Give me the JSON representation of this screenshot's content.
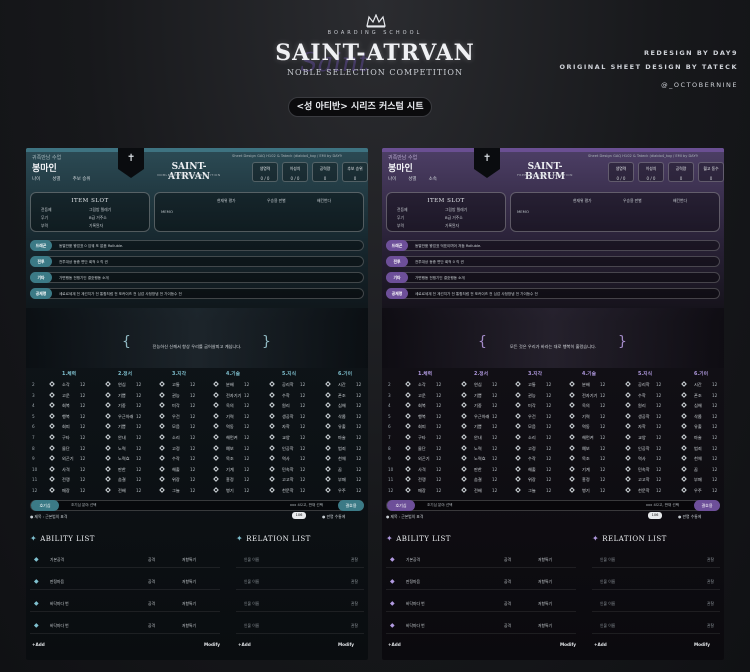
{
  "header": {
    "school_tag": "BOARDING SCHOOL",
    "logo_title": "SAINT-ATRVAN",
    "logo_script": "Saint",
    "logo_subtitle": "NOBLE SELECTION COMPETITION",
    "credit_1": "REDESIGN BY DAY9",
    "credit_2": "ORIGINAL SHEET DESIGN BY TATECK",
    "handle": "@_OCTOBERNINE",
    "sheet_title": "<성 아티반> 시리즈 커스텀 시트"
  },
  "colors": {
    "teal": "#3b7a86",
    "purple": "#6d4f99",
    "background": "#17181b"
  },
  "sheets": [
    {
      "id": "teal",
      "label": "귀족만남 수업",
      "name": "봉마인",
      "logo": "SAINT-ATRVAN",
      "logo_sub": "NOBLE SELECTION COMPETITION",
      "credit": "Sheet Design GAQ H102 & Tateck (diablo4_tog / EMI by DAY9",
      "info": [
        "나이",
        "성별",
        "추보 승위"
      ],
      "stats": [
        {
          "label": "생명력",
          "value": "0 / 0"
        },
        {
          "label": "이성치",
          "value": "0 / 0"
        },
        {
          "label": "공력량",
          "value": "0"
        },
        {
          "label": "추보 승위",
          "value": "0"
        }
      ],
      "item_slot_title": "ITEM SLOT",
      "item_slots": [
        "전등제",
        "그림방 텔레기",
        "무기",
        "B급 거주소",
        "부력",
        "기록된자"
      ],
      "memo_label": "MEMO",
      "memo_items": [
        "현재위 평가",
        "우승용 판별",
        "배킨번다"
      ],
      "fields": [
        {
          "tag": "드래곤",
          "text": "동열반품    왕업표 0    임궤 또 없음    Rolluble."
        },
        {
          "tag": "전투",
          "text": "전투대상    동종 면단    회적 0    직 권"
        },
        {
          "tag": "기타",
          "text": "가변행동    전쟁기인    결호행동    소개"
        },
        {
          "tag": "공재명",
          "text": "세로르세계 전    계선지가 전    통합처럼 전    포커이즈 전    심감    사정망념 전    가이등수 전"
        }
      ],
      "banner_text": "전능하신 신께서 항상 우리를 굽어살피고 계십니다.",
      "categories": [
        "1.체력",
        "2.정서",
        "3.지각",
        "4.기술",
        "5.지식",
        "6.기이"
      ],
      "grid_rows": [
        [
          "2",
          "소각",
          "연심",
          "고통",
          "분배",
          "공리학",
          "시간"
        ],
        [
          "3",
          "고운",
          "기쁨",
          "권능",
          "전자기기",
          "수학",
          "폰조"
        ],
        [
          "4",
          "회복",
          "기중",
          "미각",
          "옥의",
          "원리",
          "심해"
        ],
        [
          "5",
          "행복",
          "우근아래",
          "우건",
          "기력",
          "생공학",
          "삭롭"
        ],
        [
          "6",
          "회피",
          "기쁨",
          "모음",
          "역동",
          "자학",
          "유출"
        ],
        [
          "7",
          "구타",
          "안내",
          "소리",
          "해먼켜",
          "교양",
          "마술"
        ],
        [
          "8",
          "물단",
          "노력",
          "고정",
          "예보",
          "인공학",
          "범죄"
        ],
        [
          "9",
          "외곤기",
          "노력효",
          "수작",
          "목조",
          "역사",
          "천체"
        ],
        [
          "10",
          "사격",
          "판한",
          "해출",
          "기계",
          "민속학",
          "꿈"
        ],
        [
          "11",
          "전쟁",
          "숨결",
          "위장",
          "흥정",
          "고고학",
          "부패"
        ],
        [
          "12",
          "매장",
          "전배",
          "그늘",
          "병기",
          "천문학",
          "우주"
        ]
      ],
      "grid_value": "12",
      "foot_bar": {
        "label": "호기심",
        "text": "조기심 분야 선택",
        "right": "xxx 4으고, 판재 선택",
        "roll": "결호용"
      },
      "sub_line": {
        "text": "● 제목 : 근본법의 표격",
        "pill": "106",
        "right": "● 판명 수통에"
      },
      "ability_title": "ABILITY LIST",
      "relation_title": "RELATION LIST",
      "abilities": [
        {
          "name": "기본공격",
          "t1": "공격",
          "t2": "저항특기"
        },
        {
          "name": "판정마음",
          "t1": "공격",
          "t2": "저항특기"
        },
        {
          "name": "바닥마다 번",
          "t1": "공격",
          "t2": "저항특기"
        },
        {
          "name": "바닥마다 번",
          "t1": "공격",
          "t2": "저항특기"
        }
      ],
      "relations": [
        {
          "name": "인물 이름",
          "key": "관찰"
        },
        {
          "name": "인물 이름",
          "key": "관찰"
        },
        {
          "name": "인물 이름",
          "key": "관찰"
        },
        {
          "name": "인물 이름",
          "key": "관찰"
        }
      ],
      "add_label": "+Add",
      "modify_label": "Modify"
    },
    {
      "id": "purple",
      "label": "귀족만남 수업",
      "name": "봉마인",
      "logo": "SAINT-BARUM",
      "logo_sub": "FREEDOM COME SIMULATION",
      "credit": "Sheet Design GAQ H102 & Tateck (diablo4_tog / EMI by DAY9",
      "info": [
        "나이",
        "성별",
        "소속"
      ],
      "stats": [
        {
          "label": "생명력",
          "value": "0 / 0"
        },
        {
          "label": "이성치",
          "value": "0 / 0"
        },
        {
          "label": "공력량",
          "value": "0"
        },
        {
          "label": "월고 동수",
          "value": "0"
        }
      ],
      "item_slot_title": "ITEM SLOT",
      "item_slots": [
        "전등제",
        "그림방 텔레기",
        "무기",
        "B급 거주소",
        "부력",
        "기록된자"
      ],
      "memo_label": "MEMO",
      "memo_items": [
        "현재위 평가",
        "우승용 판별",
        "배킨번다"
      ],
      "fields": [
        {
          "tag": "드래곤",
          "text": "동열반품    왕업표    억표이며어 저둠    Rolluble."
        },
        {
          "tag": "전투",
          "text": "전투대상    동종 면단    회적 0    직 권"
        },
        {
          "tag": "기타",
          "text": "가변행동    전쟁기인    결호행동    소개"
        },
        {
          "tag": "공재명",
          "text": "세로르세계 전    계선지가 전    통합처럼 전    포커이즈 전    심감    사정망념 전    가이등수 전"
        }
      ],
      "banner_text": "모든 것은 우리가 바라는 대로 행복히 흘렀습니다.",
      "categories": [
        "1.체력",
        "2.정서",
        "3.지각",
        "4.기술",
        "5.지식",
        "6.기이"
      ],
      "grid_rows": [
        [
          "2",
          "소각",
          "연심",
          "고통",
          "분배",
          "공리학",
          "시간"
        ],
        [
          "3",
          "고운",
          "기쁨",
          "권능",
          "전자기기",
          "수학",
          "폰조"
        ],
        [
          "4",
          "회복",
          "기중",
          "미각",
          "옥의",
          "원리",
          "심해"
        ],
        [
          "5",
          "행복",
          "우근아래",
          "우건",
          "기력",
          "생공학",
          "삭롭"
        ],
        [
          "6",
          "회피",
          "기쁨",
          "모음",
          "역동",
          "자학",
          "유출"
        ],
        [
          "7",
          "구타",
          "안내",
          "소리",
          "해먼켜",
          "교양",
          "마술"
        ],
        [
          "8",
          "물단",
          "노력",
          "고정",
          "예보",
          "인공학",
          "범죄"
        ],
        [
          "9",
          "외곤기",
          "노력효",
          "수작",
          "목조",
          "역사",
          "천체"
        ],
        [
          "10",
          "사격",
          "판한",
          "해출",
          "기계",
          "민속학",
          "꿈"
        ],
        [
          "11",
          "전쟁",
          "숨결",
          "위장",
          "흥정",
          "고고학",
          "부패"
        ],
        [
          "12",
          "매장",
          "전배",
          "그늘",
          "병기",
          "천문학",
          "우주"
        ]
      ],
      "grid_value": "12",
      "foot_bar": {
        "label": "호기심",
        "text": "조기심 분야 선택",
        "right": "xxx 4으고, 판재 선택",
        "roll": "결호용"
      },
      "sub_line": {
        "text": "● 제목 : 근본법의 표격",
        "pill": "106",
        "right": "● 판명 수통에"
      },
      "ability_title": "ABILITY LIST",
      "relation_title": "RELATION LIST",
      "abilities": [
        {
          "name": "기본공격",
          "t1": "공격",
          "t2": "저항특기"
        },
        {
          "name": "판정마음",
          "t1": "공격",
          "t2": "저항특기"
        },
        {
          "name": "바닥마다 번",
          "t1": "공격",
          "t2": "저항특기"
        },
        {
          "name": "바닥마다 번",
          "t1": "공격",
          "t2": "저항특기"
        }
      ],
      "relations": [
        {
          "name": "인물 이름",
          "key": "관찰"
        },
        {
          "name": "인물 이름",
          "key": "관찰"
        },
        {
          "name": "인물 이름",
          "key": "관찰"
        },
        {
          "name": "인물 이름",
          "key": "관찰"
        }
      ],
      "add_label": "+Add",
      "modify_label": "Modify"
    }
  ]
}
